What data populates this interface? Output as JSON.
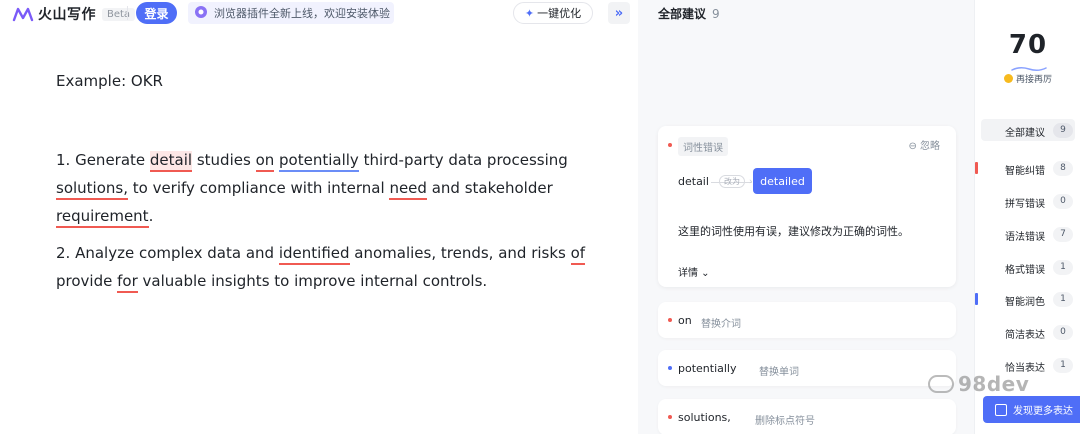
{
  "header": {
    "brand": "火山写作",
    "beta_badge": "Beta",
    "login_label": "登录",
    "notice_text": "浏览器插件全新上线，欢迎安装体验",
    "notice_close": "‹",
    "optimize_label": "一键优化",
    "collapse_glyph": "»",
    "icons": [
      "logo-icon",
      "plugin-icon",
      "sparkle-icon",
      "double-chevron-icon"
    ]
  },
  "editor": {
    "title": "Example: OKR",
    "p1": {
      "t0": "1. Generate ",
      "e1": "detail",
      "t1": " studies ",
      "e2": "on",
      "t2": " ",
      "e3": "potentially",
      "t3": " third-party data processing ",
      "e4": "solutions,",
      "t4": " to verify compliance with internal ",
      "e5": "need",
      "t5": " and stakeholder ",
      "e6": "requirement",
      "t6": "."
    },
    "p2": {
      "t0": "2. Analyze complex data and ",
      "e1": "identified",
      "t1": " anomalies, trends, and risks ",
      "e2": "of",
      "t2": " provide ",
      "e3": "for",
      "t3": " valuable insights to improve internal controls."
    }
  },
  "suggestions": {
    "title": "全部建议",
    "count": "9",
    "main_card": {
      "tag": "词性错误",
      "ignore_label": "忽略",
      "original": "detail",
      "change_chip": "改为",
      "replacement": "detailed",
      "description": "这里的词性使用有误，建议修改为正确的词性。",
      "detail_label": "详情 ⌄"
    },
    "mini_cards": [
      {
        "word": "on",
        "hint": "替换介词",
        "color": "#f05a52"
      },
      {
        "word": "potentially",
        "hint": "替换单词",
        "color": "#4f6ef7"
      },
      {
        "word": "solutions,",
        "hint": "删除标点符号",
        "color": "#f05a52"
      }
    ]
  },
  "sidebar": {
    "score": "70",
    "score_note": "再接再厉",
    "categories": [
      {
        "label": "全部建议",
        "count": "9",
        "bar": ""
      },
      {
        "label": "智能纠错",
        "count": "8",
        "bar": "#f05a52"
      },
      {
        "label": "拼写错误",
        "count": "0",
        "bar": ""
      },
      {
        "label": "语法错误",
        "count": "7",
        "bar": ""
      },
      {
        "label": "格式错误",
        "count": "1",
        "bar": ""
      },
      {
        "label": "智能润色",
        "count": "1",
        "bar": "#4f6ef7"
      },
      {
        "label": "简洁表达",
        "count": "0",
        "bar": ""
      },
      {
        "label": "恰当表达",
        "count": "1",
        "bar": ""
      }
    ],
    "more_label": "发现更多表达"
  },
  "watermark": "98dev"
}
